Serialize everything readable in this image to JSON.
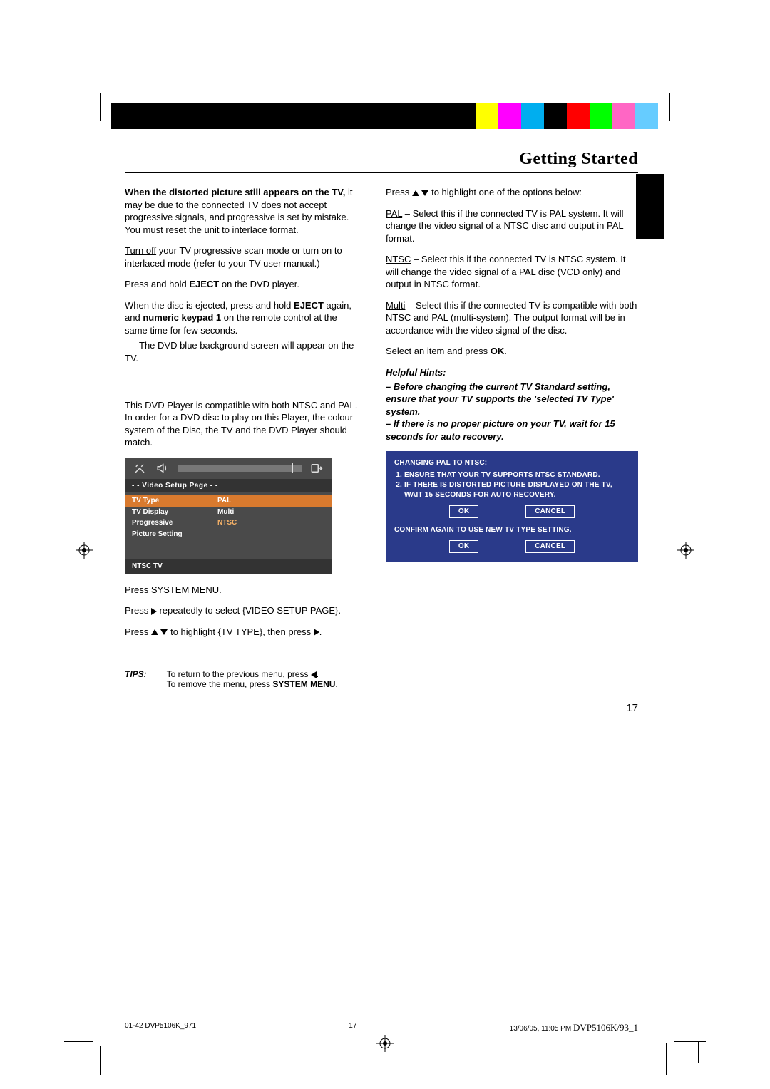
{
  "header": {
    "title": "Getting Started"
  },
  "col1": {
    "p1a": "When the distorted picture still appears on the TV,",
    "p1b": " it may be due to the connected TV does not accept progressive signals, and progressive is set by mistake.  You must reset the unit to interlace format.",
    "p2a": "Turn off",
    "p2b": " your TV progressive scan mode or turn on to interlaced mode (refer to your TV user manual.)",
    "p3a": "Press and hold ",
    "p3b": "EJECT",
    "p3c": " on the DVD player.",
    "p4a": "When the disc is ejected, press and hold ",
    "p4b": "EJECT",
    "p4c": " again, and ",
    "p4d": "numeric keypad 1",
    "p4e": " on the remote control at the same time for few seconds.",
    "p5": "The DVD blue background screen will appear on the TV.",
    "p6": "This DVD Player is compatible with both NTSC and PAL. In order for a DVD disc to play on this Player, the colour system of the Disc, the TV and the DVD Player should match.",
    "osd": {
      "page_label": "- -   Video Setup Page   - -",
      "rows": [
        {
          "label": "TV Type",
          "value": "PAL",
          "selected": true
        },
        {
          "label": "TV Display",
          "value": "Multi",
          "selected": false
        },
        {
          "label": "Progressive",
          "value": "NTSC",
          "selected": false,
          "value_orange": true
        },
        {
          "label": "Picture Setting",
          "value": "",
          "selected": false
        }
      ],
      "footer": "NTSC TV"
    },
    "p7": "Press SYSTEM MENU.",
    "p8a": "Press ",
    "p8b": " repeatedly to select {VIDEO SETUP PAGE}.",
    "p9a": "Press ",
    "p9b": " to highlight {TV TYPE}, then press ",
    "p9c": "."
  },
  "col2": {
    "p1a": "Press ",
    "p1b": " to highlight one of the options below:",
    "pal_label": "PAL",
    "pal_text": " – Select this if the connected TV is PAL system. It will change the video signal of a NTSC disc and output in PAL format.",
    "ntsc_label": "NTSC",
    "ntsc_text": " – Select this if the connected TV is NTSC system.  It will change the video signal of a PAL disc (VCD only) and output in NTSC format.",
    "multi_label": "Multi",
    "multi_text": " – Select this if the connected TV is compatible with both NTSC and PAL (multi-system).  The output format will be in accordance with the video signal of the disc.",
    "p2a": "Select an item and press ",
    "p2b": "OK",
    "p2c": ".",
    "hints_head": "Helpful Hints:",
    "hint1": "–    Before changing the current TV Standard setting, ensure that your TV supports the 'selected TV Type' system.",
    "hint2": "–    If there is no proper picture on your TV, wait for 15 seconds for auto recovery.",
    "bluebox": {
      "title": "CHANGING PAL TO NTSC:",
      "item1": "ENSURE THAT YOUR TV SUPPORTS NTSC STANDARD.",
      "item2": "IF THERE IS DISTORTED PICTURE DISPLAYED ON THE TV, WAIT 15 SECONDS FOR AUTO RECOVERY.",
      "ok": "OK",
      "cancel": "CANCEL",
      "confirm": "CONFIRM AGAIN TO USE NEW TV TYPE SETTING."
    }
  },
  "tips": {
    "label": "TIPS:",
    "line1a": "To return to the previous menu, press ",
    "line1b": ".",
    "line2a": "To remove the menu, press ",
    "line2b": "SYSTEM MENU",
    "line2c": "."
  },
  "page_number": "17",
  "footer": {
    "left": "01-42 DVP5106K_971",
    "center": "17",
    "right_time": "13/06/05, 11:05 PM",
    "model": "DVP5106K/93_1"
  }
}
